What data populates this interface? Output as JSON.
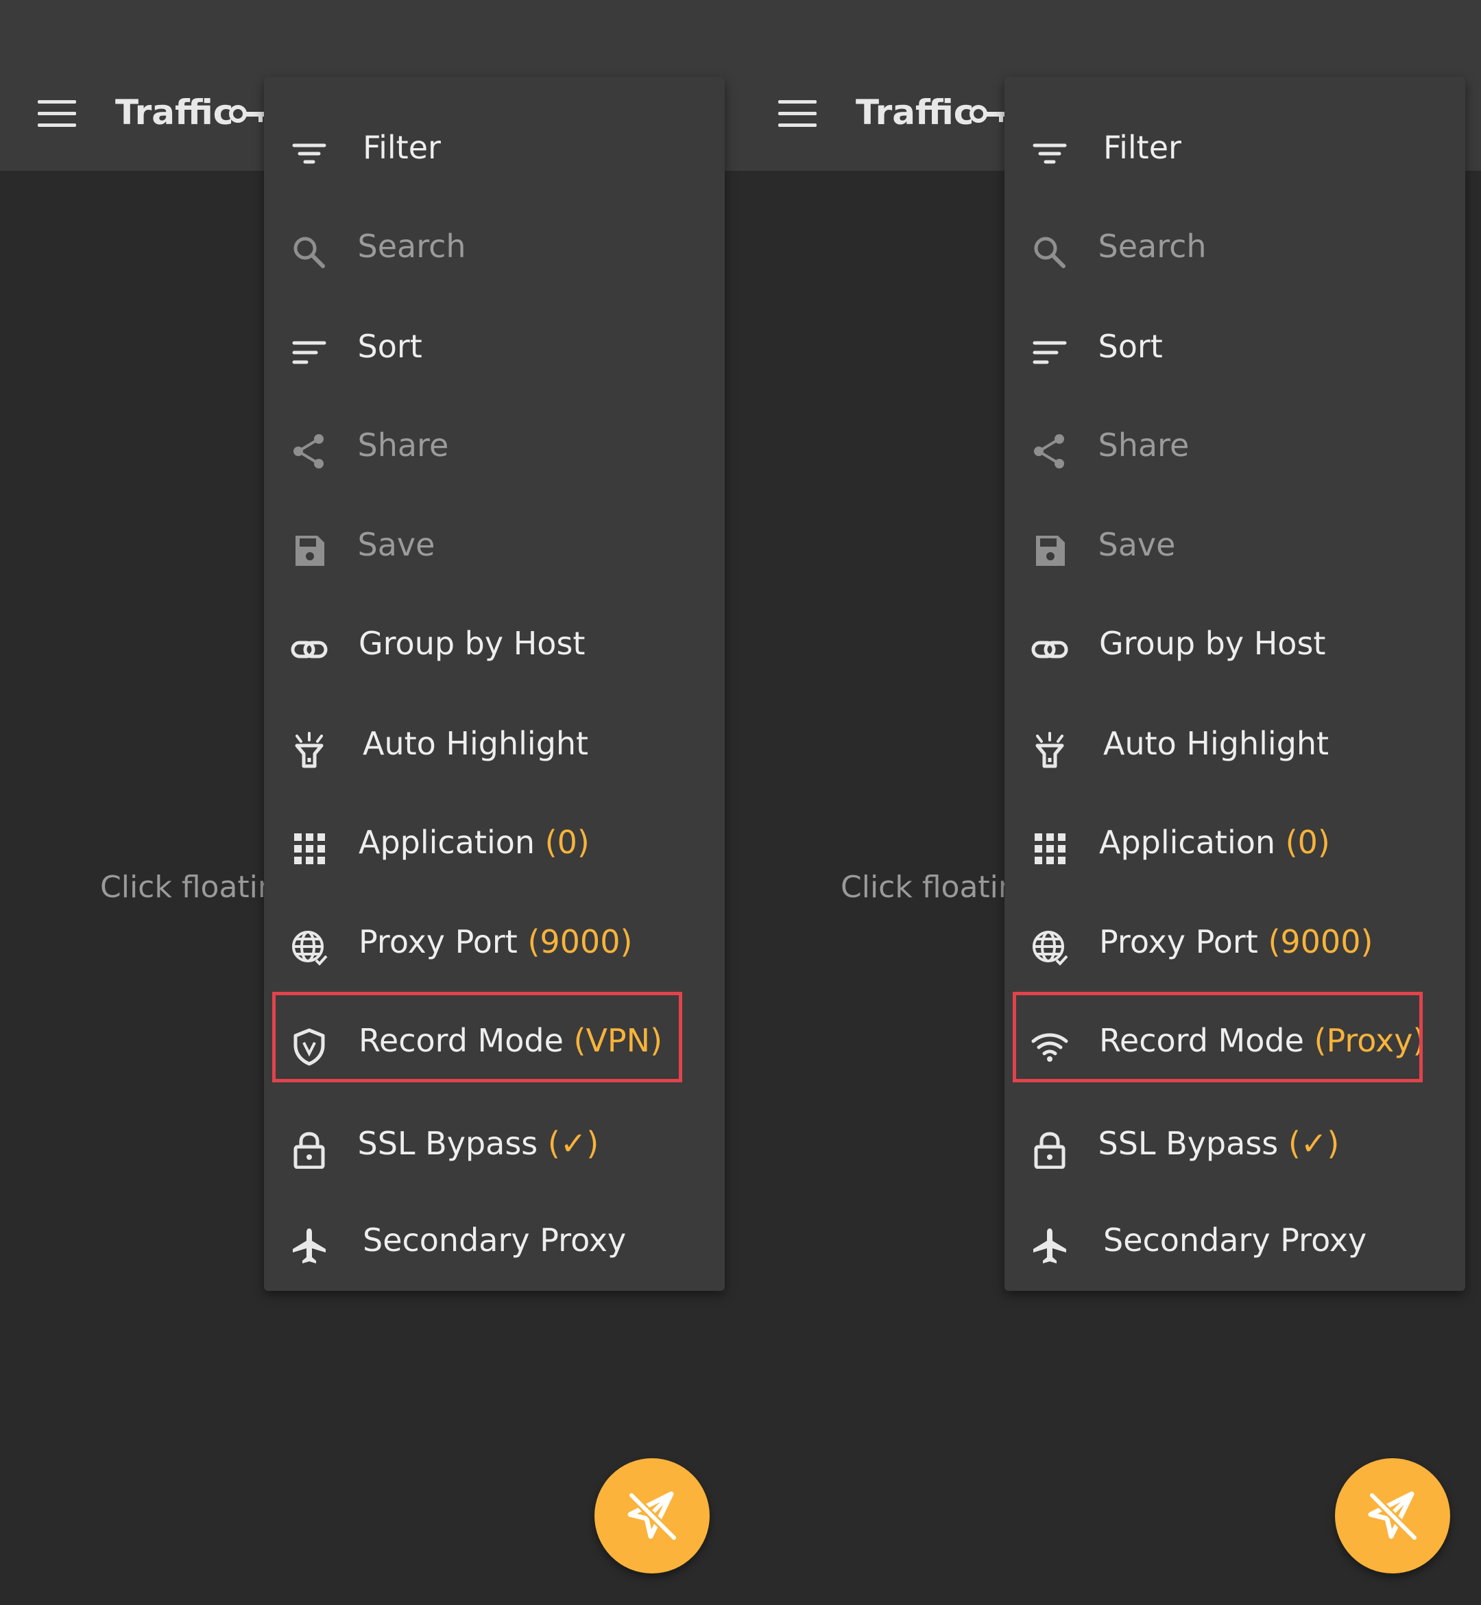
{
  "panels": [
    {
      "app_title": "Traffic",
      "empty_hint": "Click floatin",
      "menu": [
        {
          "label": "Filter",
          "value": "",
          "icon": "filter-icon",
          "disabled": false
        },
        {
          "label": "Search",
          "value": "",
          "icon": "search-icon",
          "disabled": true
        },
        {
          "label": "Sort",
          "value": "",
          "icon": "sort-icon",
          "disabled": false
        },
        {
          "label": "Share",
          "value": "",
          "icon": "share-icon",
          "disabled": true
        },
        {
          "label": "Save",
          "value": "",
          "icon": "save-icon",
          "disabled": true
        },
        {
          "label": "Group by Host",
          "value": "",
          "icon": "link-icon",
          "disabled": false
        },
        {
          "label": "Auto Highlight",
          "value": "",
          "icon": "flashlight-icon",
          "disabled": false
        },
        {
          "label": "Application ",
          "value": "(0)",
          "icon": "apps-grid-icon",
          "disabled": false
        },
        {
          "label": "Proxy Port ",
          "value": "(9000)",
          "icon": "globe-icon",
          "disabled": false
        },
        {
          "label": "Record Mode ",
          "value": "(VPN)",
          "icon": "vpn-shield-icon",
          "disabled": false,
          "highlighted": true
        },
        {
          "label": "SSL Bypass ",
          "value": "(✓)",
          "icon": "lock-icon",
          "disabled": false
        },
        {
          "label": "Secondary Proxy",
          "value": "",
          "icon": "airplane-icon",
          "disabled": false
        }
      ]
    },
    {
      "app_title": "Traffic",
      "empty_hint": "Click floatin",
      "menu": [
        {
          "label": "Filter",
          "value": "",
          "icon": "filter-icon",
          "disabled": false
        },
        {
          "label": "Search",
          "value": "",
          "icon": "search-icon",
          "disabled": true
        },
        {
          "label": "Sort",
          "value": "",
          "icon": "sort-icon",
          "disabled": false
        },
        {
          "label": "Share",
          "value": "",
          "icon": "share-icon",
          "disabled": true
        },
        {
          "label": "Save",
          "value": "",
          "icon": "save-icon",
          "disabled": true
        },
        {
          "label": "Group by Host",
          "value": "",
          "icon": "link-icon",
          "disabled": false
        },
        {
          "label": "Auto Highlight",
          "value": "",
          "icon": "flashlight-icon",
          "disabled": false
        },
        {
          "label": "Application ",
          "value": "(0)",
          "icon": "apps-grid-icon",
          "disabled": false
        },
        {
          "label": "Proxy Port ",
          "value": "(9000)",
          "icon": "globe-icon",
          "disabled": false
        },
        {
          "label": "Record Mode ",
          "value": "(Proxy)",
          "icon": "wifi-icon",
          "disabled": false,
          "highlighted": true
        },
        {
          "label": "SSL Bypass ",
          "value": "(✓)",
          "icon": "lock-icon",
          "disabled": false
        },
        {
          "label": "Secondary Proxy",
          "value": "",
          "icon": "airplane-icon",
          "disabled": false
        }
      ]
    }
  ],
  "colors": {
    "accent": "#f8b33a",
    "highlight": "#e2434c",
    "surface": "#3b3b3b",
    "background": "#2a2a2a"
  }
}
